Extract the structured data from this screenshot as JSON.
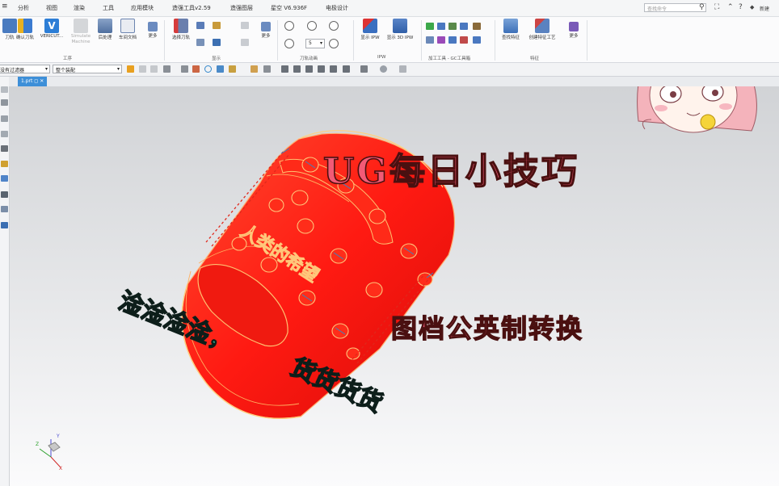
{
  "menu": {
    "items": [
      "分析",
      "视图",
      "渲染",
      "工具",
      "应用模块",
      "造强工具v2.59",
      "造强图层",
      "星空 V6.936F",
      "电极设计"
    ],
    "search_placeholder": "查找命令",
    "right_label": "新建"
  },
  "ribbon": {
    "buttons": {
      "tool": "刀轨",
      "verify": "确认刀轨",
      "vericut": "VERICUT...",
      "simulate": "Simulate Machine",
      "postprocess": "后处理",
      "shop_doc": "车间文档",
      "more1": "更多",
      "select_tool": "选择刀轨",
      "more2": "更多",
      "ipw": "显示 IPW",
      "ipw3d": "显示 3D IPW",
      "query_feature": "查找特征",
      "create_feature": "创建特征工艺",
      "more3": "更多"
    },
    "groups": {
      "process": "工序",
      "display": "显示",
      "animation": "刀轨动画",
      "ipw": "IPW",
      "gc_tools": "加工工具 - GC工具箱",
      "feature": "特征"
    },
    "speed_value": "5"
  },
  "toolbar2": {
    "filter": "没有过滤器",
    "assembly": "整个装配"
  },
  "tab": {
    "label": "1.prt"
  },
  "viewport": {
    "part_engraving": "人类的希望",
    "axes": {
      "x": "X",
      "y": "Y",
      "z": "Z"
    }
  },
  "overlay": {
    "title": "UG每日小技巧",
    "subtitle": "图档公英制转换",
    "caption1": "淦淦淦淦，",
    "caption2": "货货货货"
  },
  "colors": {
    "part_red": "#ff1a12",
    "title_pink": "#f25a76",
    "caption_teal": "#2ec3a2",
    "tab_blue": "#3d8fd8"
  }
}
